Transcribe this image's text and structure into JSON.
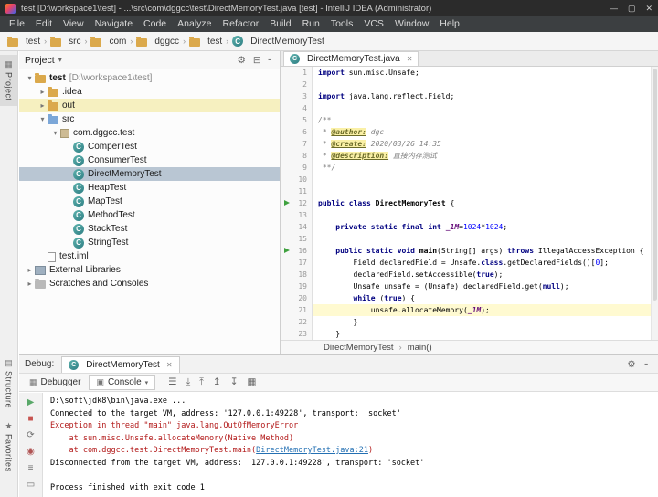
{
  "window": {
    "title": "test [D:\\workspace1\\test] - ...\\src\\com\\dggcc\\test\\DirectMemoryTest.java [test] - IntelliJ IDEA (Administrator)",
    "controls": [
      {
        "name": "minimize-button",
        "glyph": "—"
      },
      {
        "name": "maximize-button",
        "glyph": "▢"
      },
      {
        "name": "close-button",
        "glyph": "✕"
      }
    ]
  },
  "menu": {
    "items": [
      "File",
      "Edit",
      "View",
      "Navigate",
      "Code",
      "Analyze",
      "Refactor",
      "Build",
      "Run",
      "Tools",
      "VCS",
      "Window",
      "Help"
    ]
  },
  "breadcrumbs": [
    {
      "label": "test",
      "icon": "folder"
    },
    {
      "label": "src",
      "icon": "folder"
    },
    {
      "label": "com",
      "icon": "folder"
    },
    {
      "label": "dggcc",
      "icon": "folder"
    },
    {
      "label": "test",
      "icon": "folder"
    },
    {
      "label": "DirectMemoryTest",
      "icon": "class"
    }
  ],
  "tool_stripe": {
    "top": [
      {
        "label": "Project",
        "icon": "▦",
        "active": true
      }
    ],
    "bottom": [
      {
        "label": "Structure",
        "icon": "▤"
      },
      {
        "label": "Favorites",
        "icon": "★"
      }
    ]
  },
  "project": {
    "title": "Project",
    "dropdown_glyph": "▾",
    "header_icons": [
      {
        "name": "settings-icon",
        "glyph": "⚙"
      },
      {
        "name": "collapse-all-icon",
        "glyph": "⊟"
      },
      {
        "name": "hide-icon",
        "glyph": "╴"
      }
    ],
    "tree": [
      {
        "label": "test",
        "suffix": " [D:\\workspace1\\test]",
        "icon": "folder",
        "indent": 0,
        "arrow": "open",
        "bold": true
      },
      {
        "label": ".idea",
        "icon": "folder",
        "indent": 1,
        "arrow": "closed"
      },
      {
        "label": "out",
        "icon": "folder",
        "indent": 1,
        "arrow": "closed",
        "excluded": true
      },
      {
        "label": "src",
        "icon": "folder-src",
        "indent": 1,
        "arrow": "open"
      },
      {
        "label": "com.dggcc.test",
        "icon": "package",
        "indent": 2,
        "arrow": "open"
      },
      {
        "label": "ComperTest",
        "icon": "class",
        "indent": 3
      },
      {
        "label": "ConsumerTest",
        "icon": "class",
        "indent": 3
      },
      {
        "label": "DirectMemoryTest",
        "icon": "class",
        "indent": 3,
        "selected": true
      },
      {
        "label": "HeapTest",
        "icon": "class",
        "indent": 3
      },
      {
        "label": "MapTest",
        "icon": "class",
        "indent": 3
      },
      {
        "label": "MethodTest",
        "icon": "class",
        "indent": 3
      },
      {
        "label": "StackTest",
        "icon": "class",
        "indent": 3
      },
      {
        "label": "StringTest",
        "icon": "class",
        "indent": 3
      },
      {
        "label": "test.iml",
        "icon": "file",
        "indent": 1
      },
      {
        "label": "External Libraries",
        "icon": "library",
        "indent": 0,
        "arrow": "closed"
      },
      {
        "label": "Scratches and Consoles",
        "icon": "scratch",
        "indent": 0,
        "arrow": "closed"
      }
    ]
  },
  "editor": {
    "tab": {
      "label": "DirectMemoryTest.java",
      "close_glyph": "✕"
    },
    "caret_line": 21,
    "breadcrumb": {
      "class": "DirectMemoryTest",
      "sep": "›",
      "method": "main()"
    },
    "lines": [
      {
        "no": 1,
        "tokens": [
          [
            "kw",
            "import"
          ],
          [
            "pl",
            " sun.misc.Unsafe;"
          ]
        ]
      },
      {
        "no": 2,
        "tokens": []
      },
      {
        "no": 3,
        "tokens": [
          [
            "kw",
            "import"
          ],
          [
            "pl",
            " java.lang.reflect.Field;"
          ]
        ]
      },
      {
        "no": 4,
        "tokens": []
      },
      {
        "no": 5,
        "tokens": [
          [
            "cm",
            "/**"
          ]
        ]
      },
      {
        "no": 6,
        "tokens": [
          [
            "cm",
            " * "
          ],
          [
            "tag",
            "@author:"
          ],
          [
            "cm",
            " dgc"
          ]
        ]
      },
      {
        "no": 7,
        "tokens": [
          [
            "cm",
            " * "
          ],
          [
            "tag",
            "@create:"
          ],
          [
            "cm",
            " 2020/03/26 14:35"
          ]
        ]
      },
      {
        "no": 8,
        "tokens": [
          [
            "cm",
            " * "
          ],
          [
            "tag",
            "@description:"
          ],
          [
            "cm",
            " 直接内存测试"
          ]
        ]
      },
      {
        "no": 9,
        "tokens": [
          [
            "cm",
            " **/"
          ]
        ]
      },
      {
        "no": 10,
        "tokens": []
      },
      {
        "no": 11,
        "tokens": []
      },
      {
        "no": 12,
        "run": true,
        "tokens": [
          [
            "kw",
            "public class "
          ],
          [
            "decl",
            "DirectMemoryTest "
          ],
          [
            "pl",
            "{"
          ]
        ]
      },
      {
        "no": 13,
        "tokens": []
      },
      {
        "no": 14,
        "tokens": [
          [
            "pl",
            "    "
          ],
          [
            "kw",
            "private static final int "
          ],
          [
            "fld",
            "_1M"
          ],
          [
            "pl",
            "="
          ],
          [
            "num",
            "1024"
          ],
          [
            "pl",
            "*"
          ],
          [
            "num",
            "1024"
          ],
          [
            "pl",
            ";"
          ]
        ]
      },
      {
        "no": 15,
        "tokens": []
      },
      {
        "no": 16,
        "run": true,
        "tokens": [
          [
            "pl",
            "    "
          ],
          [
            "kw",
            "public static void "
          ],
          [
            "decl",
            "main"
          ],
          [
            "pl",
            "(String[] args) "
          ],
          [
            "kw",
            "throws"
          ],
          [
            "pl",
            " IllegalAccessException {"
          ]
        ]
      },
      {
        "no": 17,
        "tokens": [
          [
            "pl",
            "        Field declaredField = Unsafe."
          ],
          [
            "kw",
            "class"
          ],
          [
            "pl",
            ".getDeclaredFields()["
          ],
          [
            "num",
            "0"
          ],
          [
            "pl",
            "];"
          ]
        ]
      },
      {
        "no": 18,
        "tokens": [
          [
            "pl",
            "        declaredField.setAccessible("
          ],
          [
            "kw",
            "true"
          ],
          [
            "pl",
            ");"
          ]
        ]
      },
      {
        "no": 19,
        "tokens": [
          [
            "pl",
            "        Unsafe unsafe = (Unsafe) declaredField.get("
          ],
          [
            "kw",
            "null"
          ],
          [
            "pl",
            ");"
          ]
        ]
      },
      {
        "no": 20,
        "tokens": [
          [
            "pl",
            "        "
          ],
          [
            "kw",
            "while"
          ],
          [
            "pl",
            " ("
          ],
          [
            "kw",
            "true"
          ],
          [
            "pl",
            ") {"
          ]
        ]
      },
      {
        "no": 21,
        "tokens": [
          [
            "pl",
            "            unsafe.allocateMemory("
          ],
          [
            "fld",
            "_1M"
          ],
          [
            "pl",
            ");"
          ]
        ]
      },
      {
        "no": 22,
        "tokens": [
          [
            "pl",
            "        }"
          ]
        ]
      },
      {
        "no": 23,
        "tokens": [
          [
            "pl",
            "    }"
          ]
        ]
      }
    ]
  },
  "debug": {
    "label": "Debug:",
    "session_tab": {
      "label": "DirectMemoryTest",
      "close_glyph": "✕"
    },
    "view_tabs": [
      {
        "label": "Debugger",
        "icon": "▦",
        "active": false
      },
      {
        "label": "Console",
        "icon": "▣",
        "active": true,
        "dropdown": "▾"
      }
    ],
    "toolbar_icons": [
      {
        "name": "view-options-icon",
        "glyph": "☰"
      },
      {
        "name": "scroll-down-icon",
        "glyph": "⤓"
      },
      {
        "name": "scroll-up-icon",
        "glyph": "⤒"
      },
      {
        "name": "move-up-icon",
        "glyph": "↥"
      },
      {
        "name": "move-down-icon",
        "glyph": "↧"
      },
      {
        "name": "layout-icon",
        "glyph": "▦"
      }
    ],
    "header_icons": [
      {
        "name": "settings-icon",
        "glyph": "⚙"
      },
      {
        "name": "hide-icon",
        "glyph": "╴"
      }
    ],
    "side_icons": [
      {
        "name": "resume-button",
        "glyph": "▶",
        "color": "#59a869"
      },
      {
        "name": "stop-button",
        "glyph": "■",
        "color": "#c75450"
      },
      {
        "name": "rerun-button",
        "glyph": "⟳",
        "color": "#6e6e6e"
      },
      {
        "name": "mute-breakpoints-icon",
        "glyph": "◉",
        "color": "#b05454"
      },
      {
        "name": "console-options-icon",
        "glyph": "≡",
        "color": "#6e6e6e"
      },
      {
        "name": "clear-console-icon",
        "glyph": "▭",
        "color": "#6e6e6e"
      }
    ],
    "console": [
      {
        "type": "plain",
        "text": "D:\\soft\\jdk8\\bin\\java.exe ..."
      },
      {
        "type": "plain",
        "text": "Connected to the target VM, address: '127.0.0.1:49228', transport: 'socket'"
      },
      {
        "type": "error",
        "text": "Exception in thread \"main\" java.lang.OutOfMemoryError"
      },
      {
        "type": "error",
        "text": "    at sun.misc.Unsafe.allocateMemory(Native Method)"
      },
      {
        "type": "error",
        "pre": "    at com.dggcc.test.DirectMemoryTest.main(",
        "link": "DirectMemoryTest.java:21",
        "post": ")"
      },
      {
        "type": "plain",
        "text": "Disconnected from the target VM, address: '127.0.0.1:49228', transport: 'socket'"
      },
      {
        "type": "plain",
        "text": ""
      },
      {
        "type": "plain",
        "text": "Process finished with exit code 1"
      }
    ]
  },
  "colors": {
    "run_green": "#3fa13f",
    "error_red": "#b21818",
    "link_blue": "#2470b3",
    "selection": "#b9c6d3",
    "excluded_bg": "#f6f0c0",
    "caret_line_bg": "#fffad1"
  }
}
